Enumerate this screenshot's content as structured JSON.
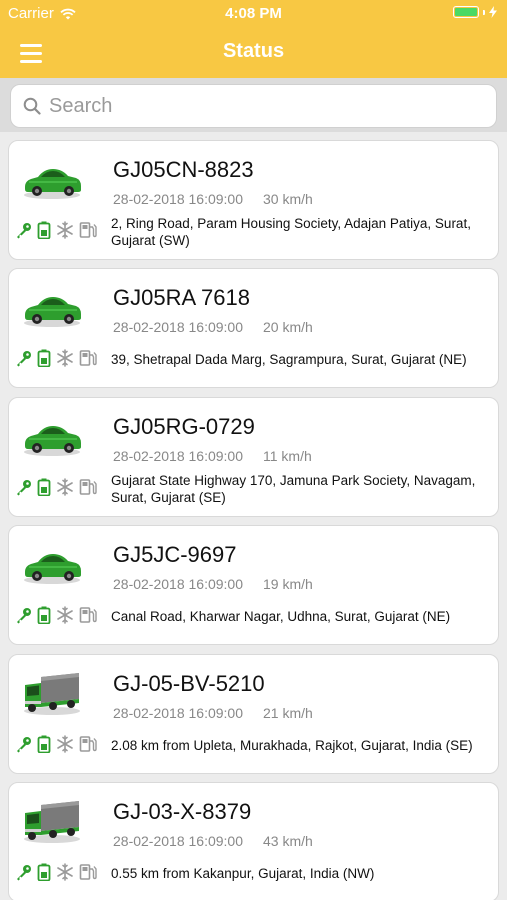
{
  "status_bar": {
    "carrier": "Carrier",
    "time": "4:08 PM"
  },
  "header": {
    "title": "Status",
    "menu_icon": "hamburger-menu-icon"
  },
  "search": {
    "placeholder": "Search",
    "value": ""
  },
  "colors": {
    "header_bg": "#f8c843",
    "vehicle_green": "#2e9e2e",
    "status_green": "#2e9e2e",
    "status_grey": "#9a9a9a"
  },
  "vehicles": [
    {
      "plate": "GJ05CN-8823",
      "datetime": "28-02-2018 16:09:00",
      "speed": "30 km/h",
      "address": "2, Ring Road, Param Housing Society, Adajan Patiya, Surat, Gujarat (SW)",
      "type": "car"
    },
    {
      "plate": "GJ05RA 7618",
      "datetime": "28-02-2018 16:09:00",
      "speed": "20 km/h",
      "address": "39, Shetrapal Dada Marg, Sagrampura, Surat, Gujarat (NE)",
      "type": "car"
    },
    {
      "plate": "GJ05RG-0729",
      "datetime": "28-02-2018 16:09:00",
      "speed": "11 km/h",
      "address": "Gujarat State Highway 170, Jamuna Park Society, Navagam, Surat, Gujarat (SE)",
      "type": "car"
    },
    {
      "plate": "GJ5JC-9697",
      "datetime": "28-02-2018 16:09:00",
      "speed": "19 km/h",
      "address": "Canal Road, Kharwar Nagar, Udhna, Surat, Gujarat (NE)",
      "type": "car"
    },
    {
      "plate": "GJ-05-BV-5210",
      "datetime": "28-02-2018 16:09:00",
      "speed": "21 km/h",
      "address": "2.08 km from Upleta, Murakhada, Rajkot, Gujarat, India (SE)",
      "type": "truck"
    },
    {
      "plate": "GJ-03-X-8379",
      "datetime": "28-02-2018 16:09:00",
      "speed": "43 km/h",
      "address": "0.55 km from Kakanpur, Gujarat, India (NW)",
      "type": "truck"
    }
  ]
}
